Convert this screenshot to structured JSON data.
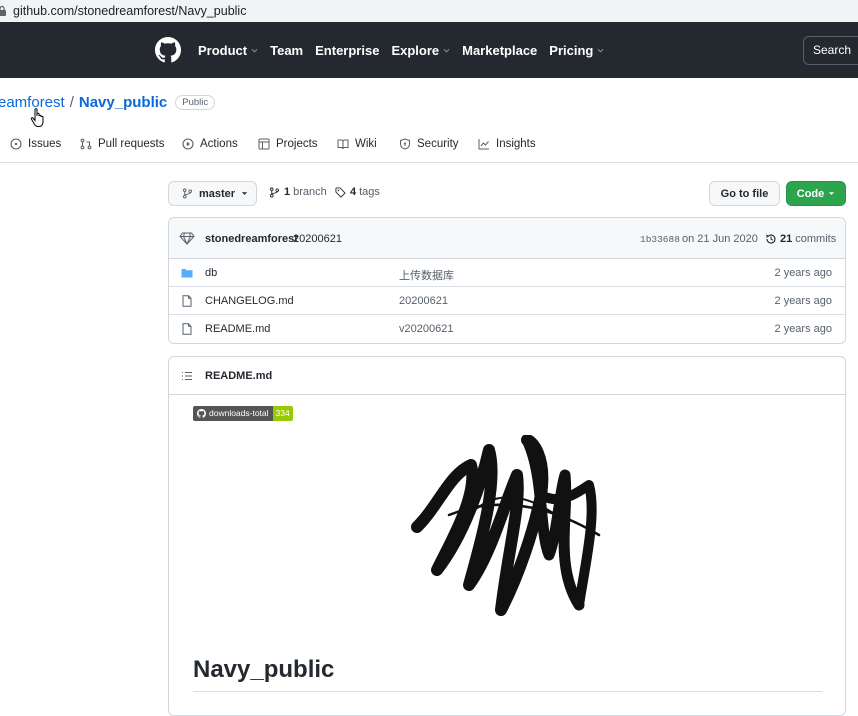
{
  "browser": {
    "url": "github.com/stonedreamforest/Navy_public"
  },
  "header": {
    "nav": [
      {
        "label": "Product",
        "caret": true
      },
      {
        "label": "Team",
        "caret": false
      },
      {
        "label": "Enterprise",
        "caret": false
      },
      {
        "label": "Explore",
        "caret": true
      },
      {
        "label": "Marketplace",
        "caret": false
      },
      {
        "label": "Pricing",
        "caret": true
      }
    ],
    "search_placeholder": "Search"
  },
  "repo": {
    "owner": "eamforest",
    "separator": "/",
    "name": "Navy_public",
    "visibility": "Public"
  },
  "tabs": [
    {
      "label": "Issues",
      "icon": "issue-icon"
    },
    {
      "label": "Pull requests",
      "icon": "pull-request-icon"
    },
    {
      "label": "Actions",
      "icon": "actions-icon"
    },
    {
      "label": "Projects",
      "icon": "projects-icon"
    },
    {
      "label": "Wiki",
      "icon": "wiki-icon"
    },
    {
      "label": "Security",
      "icon": "shield-icon"
    },
    {
      "label": "Insights",
      "icon": "graph-icon"
    }
  ],
  "branch": {
    "current": "master",
    "branch_count": "1",
    "branch_label": "branch",
    "tag_count": "4",
    "tag_label": "tags",
    "goto_label": "Go to file",
    "code_label": "Code"
  },
  "commit": {
    "author": "stonedreamforest",
    "message": "20200621",
    "sha": "1b33688",
    "date": "on 21 Jun 2020",
    "count": "21",
    "count_label": "commits"
  },
  "files": [
    {
      "type": "folder",
      "name": "db",
      "commit": "上传数据库",
      "age": "2 years ago"
    },
    {
      "type": "file",
      "name": "CHANGELOG.md",
      "commit": "20200621",
      "age": "2 years ago"
    },
    {
      "type": "file",
      "name": "README.md",
      "commit": "v20200621",
      "age": "2 years ago"
    }
  ],
  "readme": {
    "filename": "README.md",
    "badge_label": "downloads-total",
    "badge_value": "334",
    "heading": "Navy_public"
  },
  "colors": {
    "header_bg": "#24292f",
    "link": "#0969da",
    "code_button": "#2da44e",
    "folder": "#54aeff",
    "badge_value_bg": "#97ca00"
  }
}
